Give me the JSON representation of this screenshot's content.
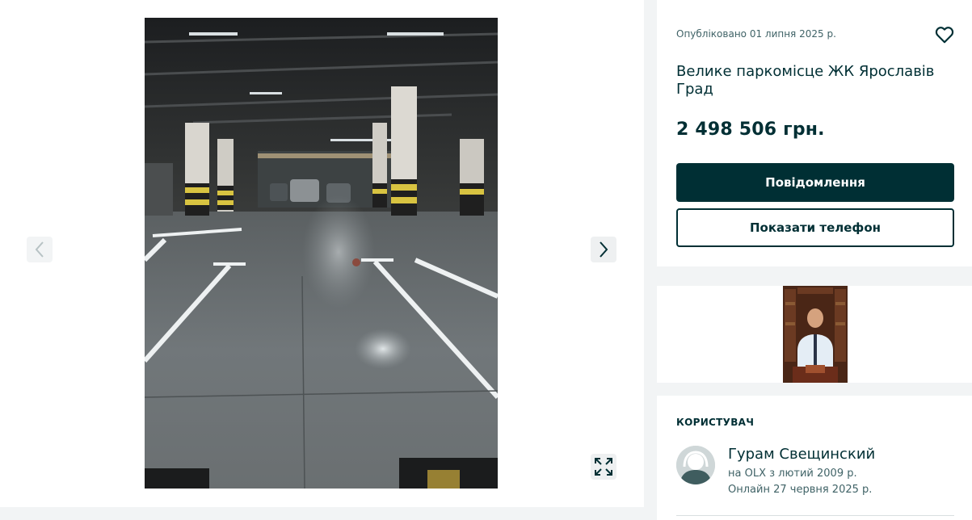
{
  "gallery": {
    "photo_alt": "",
    "prev_icon": "chevron-left-icon",
    "next_icon": "chevron-right-icon",
    "fullscreen_icon": "expand-icon"
  },
  "listing": {
    "posted": "Опубліковано 01 липня 2025 р.",
    "title": "Велике паркомісце ЖК Ярославів Град",
    "price": "2 498 506 грн.",
    "favorite_icon": "heart-icon"
  },
  "actions": {
    "message_label": "Повідомлення",
    "phone_label": "Показати телефон"
  },
  "user": {
    "heading": "КОРИСТУВАЧ",
    "name": "Гурам Свещинский",
    "since": "на OLX з лютий 2009 р.",
    "online": "Онлайн 27 червня 2025 р.",
    "avatar_icon": "user-avatar-icon"
  },
  "colors": {
    "primary": "#002f34",
    "background": "#f2f4f5",
    "muted": "#406367"
  }
}
